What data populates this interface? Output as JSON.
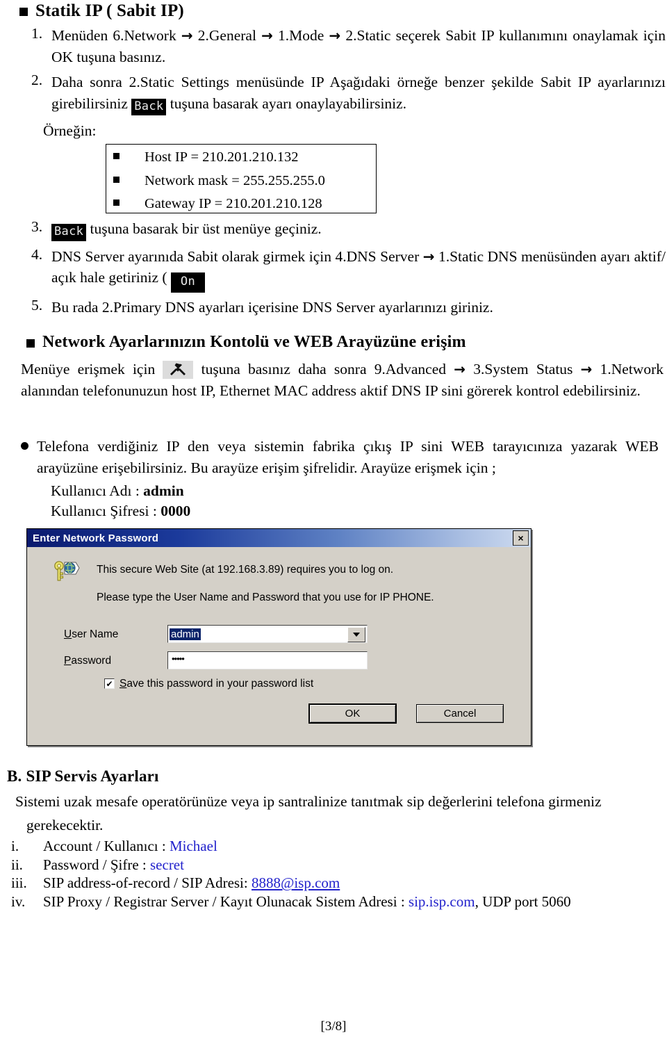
{
  "section_a": {
    "heading": "Statik IP ( Sabit  IP)",
    "steps": [
      {
        "num": "1.",
        "parts": [
          {
            "t": "text",
            "v": "Menüden   6.Network  "
          },
          {
            "t": "arrow",
            "v": "→"
          },
          {
            "t": "text",
            "v": "  2.General  "
          },
          {
            "t": "arrow",
            "v": "→"
          },
          {
            "t": "text",
            "v": "  1.Mode  "
          },
          {
            "t": "arrow",
            "v": "→"
          },
          {
            "t": "text",
            "v": "  2.Static seçerek Sabit IP kullanımını onaylamak için   OK   tuşuna basınız."
          }
        ]
      },
      {
        "num": "2.",
        "parts": [
          {
            "t": "text",
            "v": "Daha sonra   2.Static Settings   menüsünde IP Aşağıdaki örneğe benzer şekilde Sabit IP ayarlarınızı girebilirsiniz  "
          },
          {
            "t": "badge",
            "v": "Back"
          },
          {
            "t": "text",
            "v": " tuşuna basarak ayarı onaylayabilirsiniz."
          }
        ]
      }
    ],
    "ornegin_label": "Örneğin:",
    "example_box": {
      "rows": [
        "Host IP = 210.201.210.132",
        "Network mask = 255.255.255.0",
        "Gateway IP = 210.201.210.128"
      ]
    },
    "steps2": [
      {
        "num": "3.",
        "parts": [
          {
            "t": "badge",
            "v": "Back"
          },
          {
            "t": "text",
            "v": " tuşuna basarak bir üst menüye geçiniz."
          }
        ]
      },
      {
        "num": "4.",
        "parts": [
          {
            "t": "text",
            "v": "DNS  Server  ayarınıda  Sabit  olarak  girmek  için    4.DNS  Server  "
          },
          {
            "t": "arrow",
            "v": "→"
          },
          {
            "t": "text",
            "v": "  1.Static  DNS menüsünden ayarı aktif/ açık hale getiriniz ( "
          },
          {
            "t": "badge-on",
            "v": "On"
          }
        ]
      },
      {
        "num": "5.",
        "parts": [
          {
            "t": "text",
            "v": "Bu rada  2.Primary DNS   ayarları içerisine DNS Server ayarlarınızı giriniz."
          }
        ]
      }
    ]
  },
  "section_network": {
    "heading": "Network Ayarlarınızın Kontolü ve WEB Arayüzüne erişim",
    "paragraph_parts": [
      {
        "t": "text",
        "v": "Menüye   erişmek   için   "
      },
      {
        "t": "tool-icon",
        "v": "wrench-hammer-icon"
      },
      {
        "t": "text",
        "v": "   tuşuna   basınız   daha   sonra   9.Advanced  "
      },
      {
        "t": "arrow",
        "v": "→"
      },
      {
        "t": "text",
        "v": "  3.System Status  "
      },
      {
        "t": "arrow",
        "v": "→"
      },
      {
        "t": "text",
        "v": "  1.Network   alanından telefonunuzun  host IP, Ethernet MAC address aktif  DNS IP sini görerek kontrol edebilirsiniz."
      }
    ],
    "bullet_paragraph": "Telefona  verdiğiniz  IP den  veya  sistemin  fabrika  çıkış  IP sini  WEB  tarayıcınıza  yazarak  WEB arayüzüne erişebilirsiniz. Bu arayüze erişim şifrelidir. Arayüze erişmek için ;",
    "credentials": [
      {
        "label": "Kullanıcı Adı : ",
        "value": "admin"
      },
      {
        "label": "Kullanıcı Şifresi : ",
        "value": "0000"
      }
    ]
  },
  "dialog": {
    "title": "Enter Network Password",
    "close_label": "×",
    "line1": "This secure Web Site (at 192.168.3.89) requires you to log on.",
    "line2": "Please type the User Name and Password that you use for IP PHONE.",
    "username_label_u": "U",
    "username_label_rest": "ser Name",
    "username_value": "admin",
    "password_label_u": "P",
    "password_label_rest": "assword",
    "password_value": "•••••",
    "checkbox_checked": "✔",
    "checkbox_label_u": "S",
    "checkbox_label_rest": "ave this password in your password list",
    "ok_label": "OK",
    "cancel_label": "Cancel"
  },
  "section_b": {
    "heading": "B. SIP Servis Ayarları",
    "intro_line1": "Sistemi  uzak  mesafe  operatörünüze  veya  ip  santralinize  tanıtmak  sip  değerlerini  telefona  girmeniz",
    "intro_line2": "gerekecektir.",
    "items": [
      {
        "num": "i.",
        "label": "Account / Kullanıcı : ",
        "value": "Michael",
        "style": "blue",
        "tail": ""
      },
      {
        "num": "ii.",
        "label": "Password / Şifre : ",
        "value": "secret",
        "style": "blue",
        "tail": ""
      },
      {
        "num": "iii.",
        "label": "SIP address-of-record / SIP Adresi: ",
        "value": "8888@isp.com",
        "style": "bluelink",
        "tail": ""
      },
      {
        "num": "iv.",
        "label": "SIP Proxy / Registrar Server / Kayıt Olunacak Sistem Adresi : ",
        "value": "sip.isp.com",
        "style": "blue",
        "tail": ",  UDP port 5060"
      }
    ]
  },
  "footer": {
    "page_marker": "[3/8]"
  },
  "colors": {
    "link": "#2222cc",
    "dialog_face": "#d4d0c8",
    "title_start": "#0a1a6e",
    "title_end": "#cfdcf0",
    "selection": "#0a246a"
  }
}
